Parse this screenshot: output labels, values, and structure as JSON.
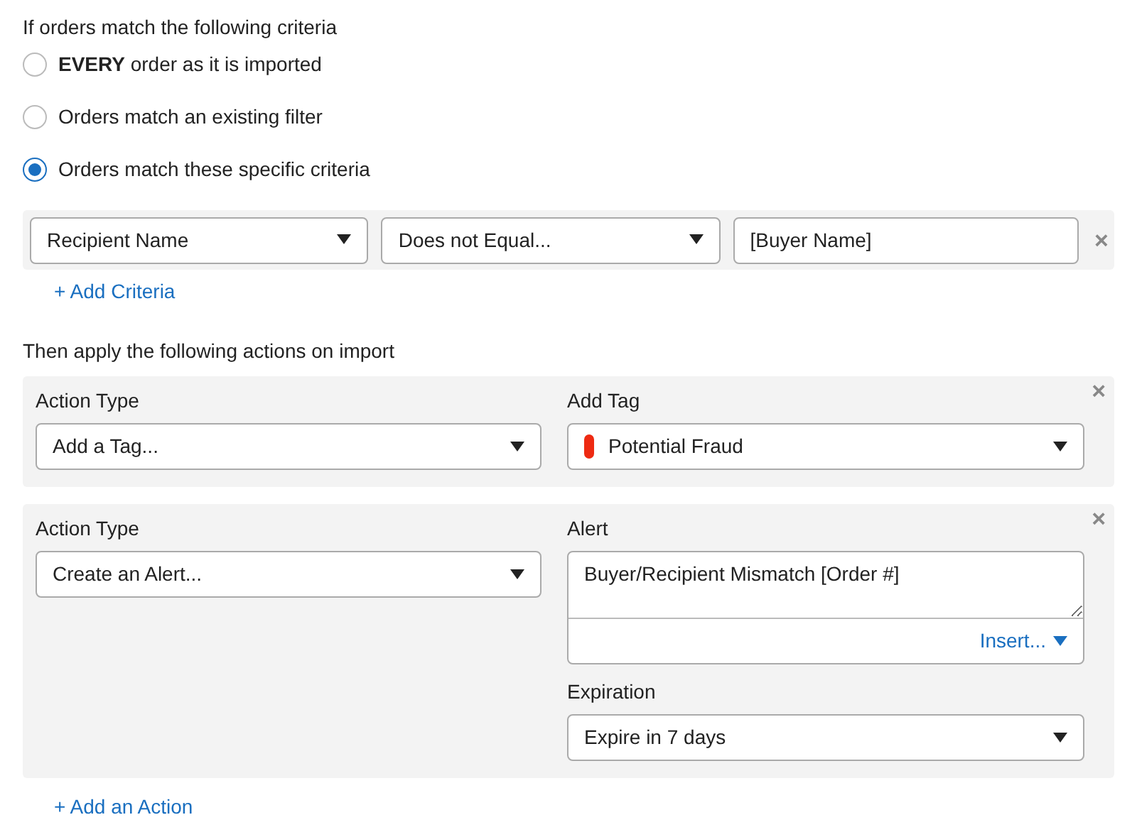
{
  "criteria": {
    "heading": "If orders match the following criteria",
    "options": [
      {
        "label": "**EVERY** order as it is imported",
        "selected": false
      },
      {
        "label": "Orders match an existing filter",
        "selected": false
      },
      {
        "label": "Orders match these specific criteria",
        "selected": true
      }
    ],
    "rows": [
      {
        "field": "Recipient Name",
        "operator": "Does not Equal...",
        "value": "[Buyer Name]",
        "remove": "×"
      }
    ],
    "add": "+ Add Criteria"
  },
  "actions": {
    "heading": "Then apply the following actions on import",
    "items": [
      {
        "kind": "tag",
        "type_label": "Action Type",
        "type_value": "Add a Tag...",
        "tag_label": "Add Tag",
        "tag_value": "Potential Fraud",
        "color": "#ee2a12",
        "remove": "×"
      },
      {
        "kind": "alert",
        "type_label": "Action Type",
        "type_value": "Create an Alert...",
        "alert_label": "Alert",
        "alert_text": "Buyer/Recipient Mismatch [Order #]",
        "insert": "Insert...",
        "expiration_label": "Expiration",
        "expiration_value": "Expire in 7 days",
        "remove": "×"
      }
    ],
    "add": "+ Add an Action"
  }
}
